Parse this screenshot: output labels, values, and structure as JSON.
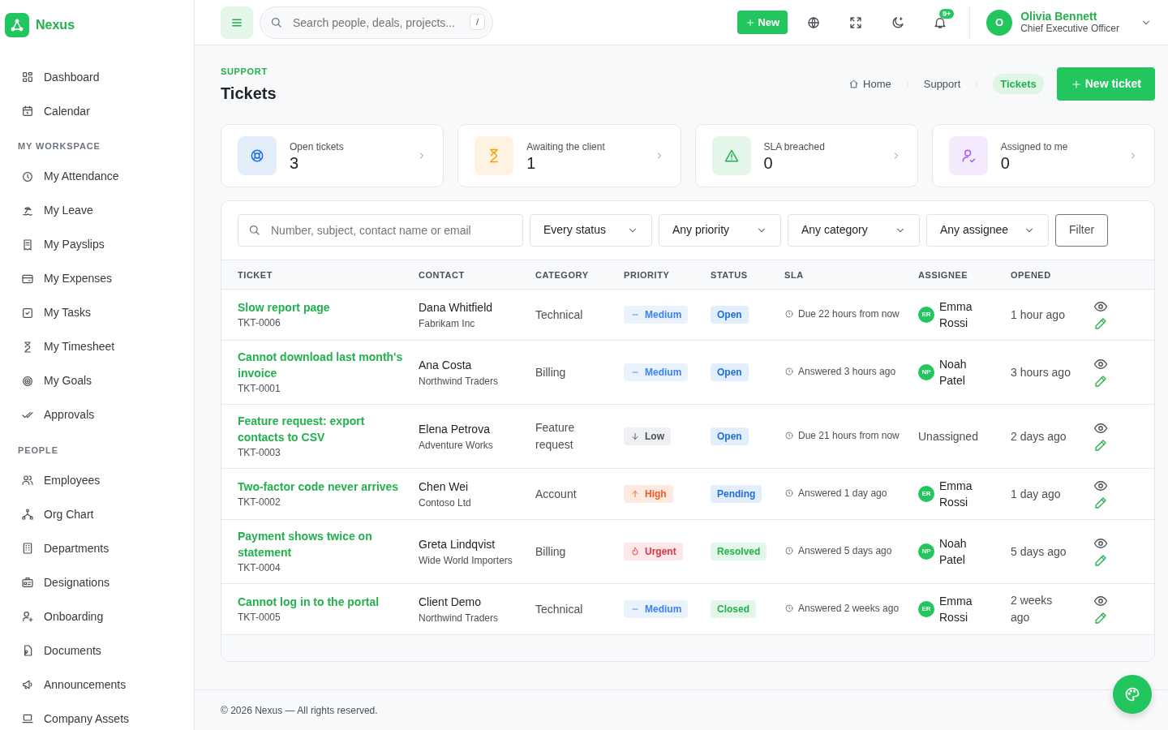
{
  "brand": {
    "name": "Nexus"
  },
  "sidebar": {
    "sections": [
      {
        "items": [
          {
            "label": "Dashboard"
          },
          {
            "label": "Calendar"
          }
        ]
      },
      {
        "heading": "MY WORKSPACE",
        "items": [
          {
            "label": "My Attendance"
          },
          {
            "label": "My Leave"
          },
          {
            "label": "My Payslips"
          },
          {
            "label": "My Expenses"
          },
          {
            "label": "My Tasks"
          },
          {
            "label": "My Timesheet"
          },
          {
            "label": "My Goals"
          },
          {
            "label": "Approvals"
          }
        ]
      },
      {
        "heading": "PEOPLE",
        "items": [
          {
            "label": "Employees"
          },
          {
            "label": "Org Chart"
          },
          {
            "label": "Departments"
          },
          {
            "label": "Designations"
          },
          {
            "label": "Onboarding"
          },
          {
            "label": "Documents"
          },
          {
            "label": "Announcements"
          },
          {
            "label": "Company Assets"
          }
        ]
      }
    ]
  },
  "topbar": {
    "search": {
      "placeholder": "Search people, deals, projects...",
      "shortcut": "/"
    },
    "new_button": "New",
    "notification_badge": "9+",
    "user": {
      "initial": "O",
      "name": "Olivia Bennett",
      "role": "Chief Executive Officer"
    }
  },
  "page": {
    "eyebrow": "SUPPORT",
    "title": "Tickets",
    "breadcrumb": [
      {
        "label": "Home",
        "selected": false
      },
      {
        "label": "Support",
        "selected": false
      },
      {
        "label": "Tickets",
        "selected": true
      }
    ],
    "new_button": "New ticket"
  },
  "stats": [
    {
      "label": "Open tickets",
      "value": "3",
      "color": "#1e6fd9"
    },
    {
      "label": "Awaiting the client",
      "value": "1",
      "color": "#f59e0b"
    },
    {
      "label": "SLA breached",
      "value": "0",
      "color": "#22b14c"
    },
    {
      "label": "Assigned to me",
      "value": "0",
      "color": "#a855f7"
    }
  ],
  "filters": {
    "search": {
      "placeholder": "Number, subject, contact name or email"
    },
    "selects": [
      "Every status",
      "Any priority",
      "Any category",
      "Any assignee"
    ],
    "button": "Filter"
  },
  "table": {
    "columns": [
      "TICKET",
      "CONTACT",
      "CATEGORY",
      "PRIORITY",
      "STATUS",
      "SLA",
      "ASSIGNEE",
      "OPENED"
    ],
    "rows": [
      {
        "subject": "Slow report page",
        "number": "TKT-0006",
        "contact": "Dana Whitfield",
        "company": "Fabrikam Inc",
        "category": "Technical",
        "priority": {
          "kind": "medium",
          "label": "Medium"
        },
        "status": {
          "kind": "open",
          "label": "Open"
        },
        "sla": "Due 22 hours from now",
        "assignee": {
          "initials": "ER",
          "name": "Emma Rossi"
        },
        "opened": "1 hour ago"
      },
      {
        "subject": "Cannot download last month's invoice",
        "number": "TKT-0001",
        "contact": "Ana Costa",
        "company": "Northwind Traders",
        "category": "Billing",
        "priority": {
          "kind": "medium",
          "label": "Medium"
        },
        "status": {
          "kind": "open",
          "label": "Open"
        },
        "sla": "Answered 3 hours ago",
        "assignee": {
          "initials": "NP",
          "name": "Noah Patel"
        },
        "opened": "3 hours ago"
      },
      {
        "subject": "Feature request: export contacts to CSV",
        "number": "TKT-0003",
        "contact": "Elena Petrova",
        "company": "Adventure Works",
        "category": "Feature request",
        "priority": {
          "kind": "low",
          "label": "Low"
        },
        "status": {
          "kind": "open",
          "label": "Open"
        },
        "sla": "Due 21 hours from now",
        "assignee": {
          "name": "Unassigned"
        },
        "opened": "2 days ago"
      },
      {
        "subject": "Two-factor code never arrives",
        "number": "TKT-0002",
        "contact": "Chen Wei",
        "company": "Contoso Ltd",
        "category": "Account",
        "priority": {
          "kind": "high",
          "label": "High"
        },
        "status": {
          "kind": "pending",
          "label": "Pending"
        },
        "sla": "Answered 1 day ago",
        "assignee": {
          "initials": "ER",
          "name": "Emma Rossi"
        },
        "opened": "1 day ago"
      },
      {
        "subject": "Payment shows twice on statement",
        "number": "TKT-0004",
        "contact": "Greta Lindqvist",
        "company": "Wide World Importers",
        "category": "Billing",
        "priority": {
          "kind": "urgent",
          "label": "Urgent"
        },
        "status": {
          "kind": "resolved",
          "label": "Resolved"
        },
        "sla": "Answered 5 days ago",
        "assignee": {
          "initials": "NP",
          "name": "Noah Patel"
        },
        "opened": "5 days ago"
      },
      {
        "subject": "Cannot log in to the portal",
        "number": "TKT-0005",
        "contact": "Client Demo",
        "company": "Northwind Traders",
        "category": "Technical",
        "priority": {
          "kind": "medium",
          "label": "Medium"
        },
        "status": {
          "kind": "closed",
          "label": "Closed"
        },
        "sla": "Answered 2 weeks ago",
        "assignee": {
          "initials": "ER",
          "name": "Emma Rossi"
        },
        "opened": "2 weeks ago"
      }
    ]
  },
  "footer": "© 2026 Nexus — All rights reserved."
}
